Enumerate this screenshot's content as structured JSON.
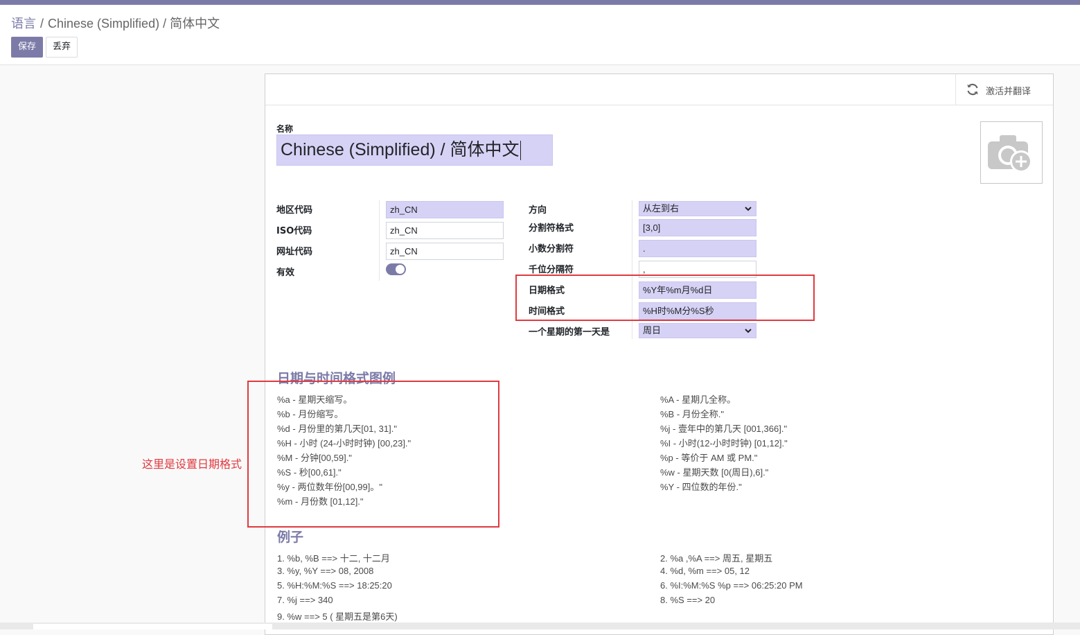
{
  "breadcrumb": {
    "parent": "语言",
    "current": "Chinese (Simplified) / 简体中文"
  },
  "toolbar": {
    "save_label": "保存",
    "discard_label": "丢弃"
  },
  "sheet_header": {
    "translate_label": "激活并翻译",
    "translate_icon": "refresh-icon"
  },
  "name_field": {
    "label": "名称",
    "value": "Chinese (Simplified) / 简体中文"
  },
  "avatar": {
    "icon": "camera-plus-icon"
  },
  "left_fields": [
    {
      "label": "地区代码",
      "value": "zh_CN",
      "required": true
    },
    {
      "label": "ISO代码",
      "value": "zh_CN",
      "required": false
    },
    {
      "label": "网址代码",
      "value": "zh_CN",
      "required": false
    },
    {
      "label": "有效",
      "value": true
    }
  ],
  "right_fields": [
    {
      "label": "方向",
      "value": "从左到右",
      "type": "select"
    },
    {
      "label": "分割符格式",
      "value": "[3,0]"
    },
    {
      "label": "小数分割符",
      "value": "."
    },
    {
      "label": "千位分隔符",
      "value": ","
    },
    {
      "label": "日期格式",
      "value": "%Y年%m月%d日"
    },
    {
      "label": "时间格式",
      "value": "%H时%M分%S秒"
    },
    {
      "label": "一个星期的第一天是",
      "value": "周日",
      "type": "select"
    }
  ],
  "legend": {
    "title": "日期与时间格式图例",
    "left": [
      "%a - 星期天缩写。",
      "%b - 月份缩写。",
      "%d - 月份里的第几天[01, 31].\"",
      "%H - 小时 (24-小时时钟) [00,23].\"",
      "%M - 分钟[00,59].\"",
      "%S - 秒[00,61].\"",
      "%y - 两位数年份[00,99]。\"",
      "%m - 月份数 [01,12].\""
    ],
    "right": [
      "%A - 星期几全称。",
      "%B - 月份全称.\"",
      "%j - 壹年中的第几天 [001,366].\"",
      "%I - 小时(12-小时时钟) [01,12].\"",
      "%p - 等价于 AM 或 PM.\"",
      "%w - 星期天数 [0(周日),6].\"",
      "%Y - 四位数的年份.\""
    ]
  },
  "examples": {
    "title": "例子",
    "left": [
      "1. %b, %B ==> 十二, 十二月",
      "3. %y, %Y ==> 08, 2008",
      "5. %H:%M:%S ==> 18:25:20",
      "7. %j ==> 340",
      "9. %w ==> 5 ( 星期五是第6天)"
    ],
    "right": [
      "2. %a ,%A ==> 周五, 星期五",
      "4. %d, %m ==> 05, 12",
      "6. %I:%M:%S %p ==> 06:25:20 PM",
      "8. %S ==> 20"
    ]
  },
  "annotation": {
    "text": "这里是设置日期格式",
    "color": "#e0393e"
  },
  "colors": {
    "brand": "#7c7ba8",
    "required_bg": "#d6d2f5",
    "annotation_red": "#e0393e"
  }
}
